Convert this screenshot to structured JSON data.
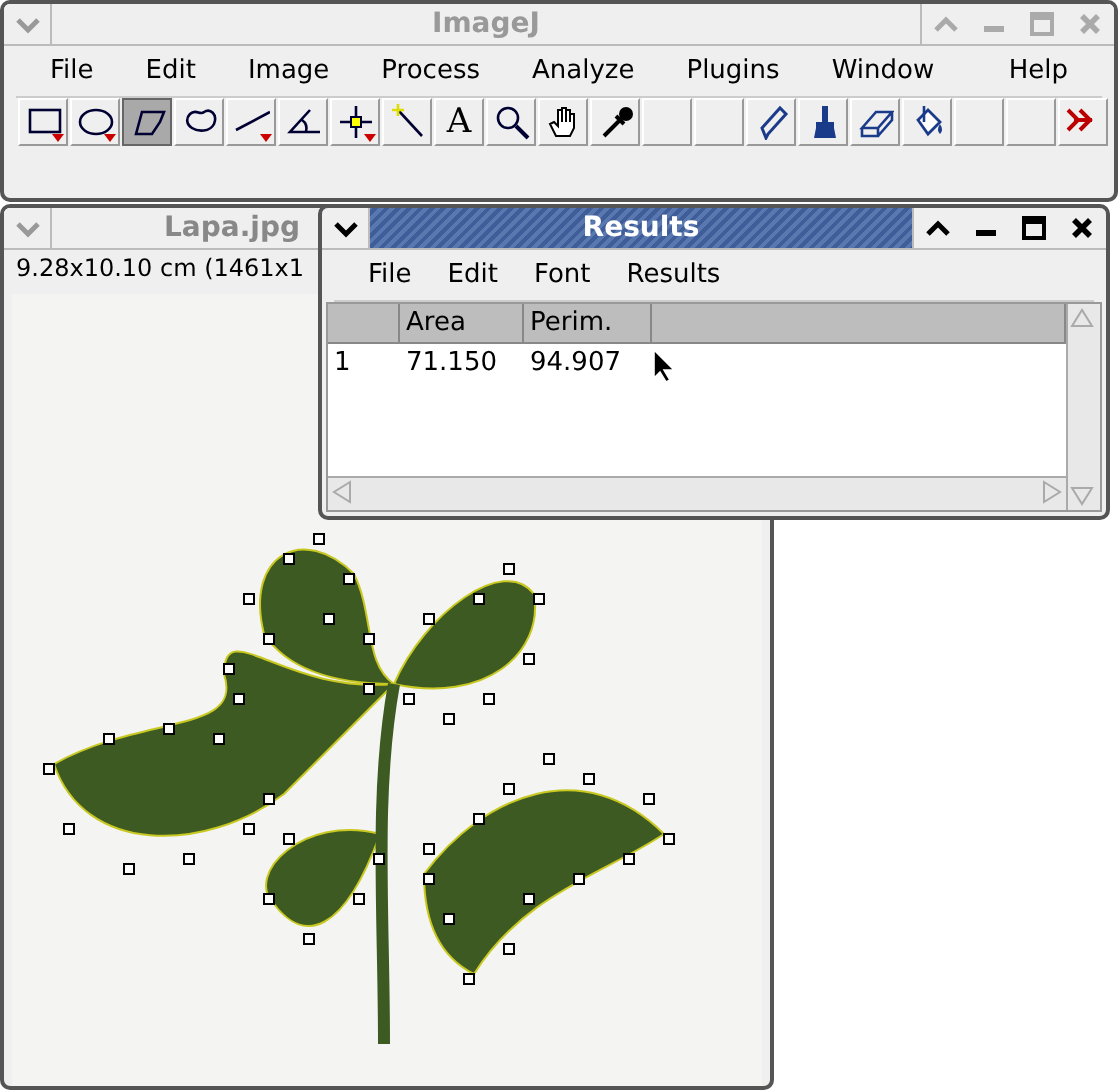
{
  "main_window": {
    "title": "ImageJ",
    "active": false,
    "menu": [
      "File",
      "Edit",
      "Image",
      "Process",
      "Analyze",
      "Plugins",
      "Window",
      "Help"
    ],
    "tools": [
      {
        "kind": "rectangle",
        "dropdown": true,
        "selected": false
      },
      {
        "kind": "oval",
        "dropdown": true,
        "selected": false
      },
      {
        "kind": "polygon",
        "dropdown": false,
        "selected": true
      },
      {
        "kind": "freehand",
        "dropdown": false,
        "selected": false
      },
      {
        "kind": "line",
        "dropdown": true,
        "selected": false
      },
      {
        "kind": "angle",
        "dropdown": false,
        "selected": false
      },
      {
        "kind": "point",
        "dropdown": true,
        "selected": false
      },
      {
        "kind": "wand",
        "dropdown": false,
        "selected": false
      },
      {
        "kind": "text",
        "glyph": "A",
        "dropdown": false,
        "selected": false
      },
      {
        "kind": "magnifier",
        "dropdown": false,
        "selected": false
      },
      {
        "kind": "hand",
        "dropdown": false,
        "selected": false
      },
      {
        "kind": "dropper",
        "dropdown": false,
        "selected": false
      },
      {
        "kind": "empty",
        "dropdown": false,
        "selected": false
      },
      {
        "kind": "empty",
        "dropdown": false,
        "selected": false
      },
      {
        "kind": "pencil",
        "dropdown": false,
        "selected": false
      },
      {
        "kind": "brush",
        "dropdown": false,
        "selected": false
      },
      {
        "kind": "eraser",
        "dropdown": false,
        "selected": false
      },
      {
        "kind": "fill",
        "dropdown": false,
        "selected": false
      },
      {
        "kind": "empty",
        "dropdown": false,
        "selected": false
      },
      {
        "kind": "empty",
        "dropdown": false,
        "selected": false
      },
      {
        "kind": "more",
        "dropdown": false,
        "selected": false
      }
    ]
  },
  "image_window": {
    "title": "Lapa.jpg",
    "active": false,
    "info": "9.28x10.10 cm (1461x1"
  },
  "results_window": {
    "title": "Results",
    "active": true,
    "menu": [
      "File",
      "Edit",
      "Font",
      "Results"
    ],
    "table": {
      "columns": [
        "",
        "Area",
        "Perim.",
        ""
      ],
      "rows": [
        [
          "1",
          "71.150",
          "94.907"
        ]
      ]
    }
  }
}
